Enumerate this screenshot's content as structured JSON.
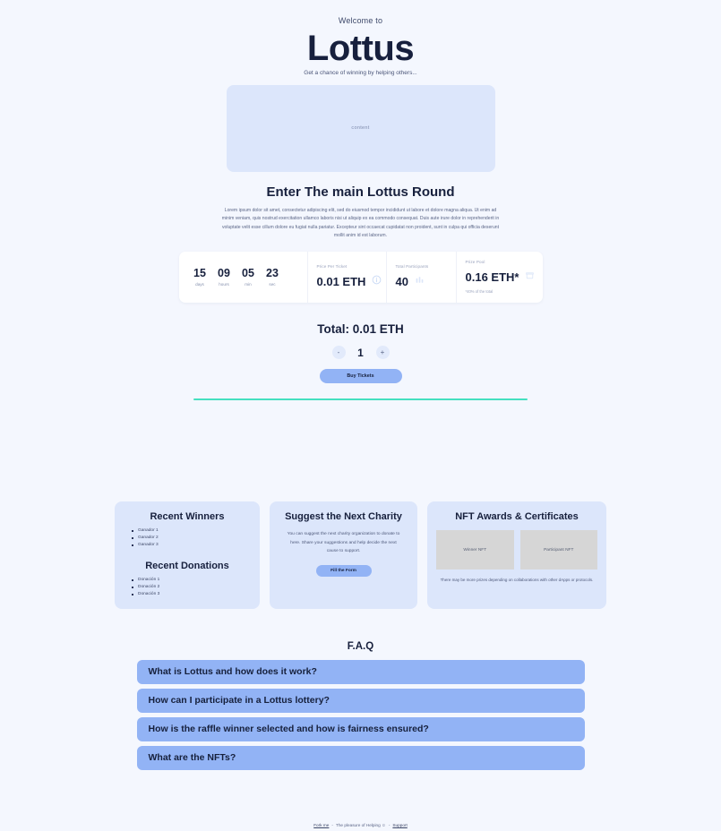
{
  "hero": {
    "welcome": "Welcome to",
    "brand": "Lottus",
    "tagline": "Get a chance of winning by helping others...",
    "media_placeholder": "content"
  },
  "round": {
    "title": "Enter The main Lottus Round",
    "description": "Lorem ipsum dolor sit amet, consectetur adipiscing elit, sed do eiusmod tempor incididunt ut labore et dolore magna aliqua. Ut enim ad minim veniam, quis nostrud exercitation ullamco laboris nisi ut aliquip ex ea commodo consequat. Duis aute irure dolor in reprehenderit in voluptate velit esse cillum dolore eu fugiat nulla pariatur. Excepteur sint occaecat cupidatat non proident, sunt in culpa qui officia deserunt mollit anim id est laborum."
  },
  "countdown": [
    {
      "value": "15",
      "label": "days"
    },
    {
      "value": "09",
      "label": "hours"
    },
    {
      "value": "05",
      "label": "min"
    },
    {
      "value": "23",
      "label": "sec"
    }
  ],
  "stats": {
    "price": {
      "label": "Price Per Ticket",
      "value": "0.01 ETH",
      "icon": "ticket-icon"
    },
    "participants": {
      "label": "Total Participants",
      "value": "40",
      "icon": "participants-icon"
    },
    "pool": {
      "label": "Prize Pool",
      "value": "0.16 ETH*",
      "note": "*40% of the total",
      "icon": "trophy-icon"
    }
  },
  "purchase": {
    "total_label": "Total: 0.01 ETH",
    "decrement": "-",
    "quantity": "1",
    "increment": "+",
    "buy_label": "Buy Tickets"
  },
  "winners_card": {
    "winners_title": "Recent Winners",
    "winners": [
      "Ganador 1",
      "Ganador 2",
      "Ganador 3"
    ],
    "donations_title": "Recent Donations",
    "donations": [
      "Donación 1",
      "Donación 2",
      "Donación 3"
    ]
  },
  "charity_card": {
    "title": "Suggest the Next Charity",
    "text": "You can suggest the next charity organization to donate to here. Share your suggestions and help decide the next cause to support.",
    "button": "Fill the Form"
  },
  "nft_card": {
    "title": "NFT Awards & Certificates",
    "thumbs": [
      "Winner NFT",
      "Participant NFT"
    ],
    "note": "There may be more prizes depending on collaborations with other dApps or protocols."
  },
  "faq": {
    "title": "F.A.Q",
    "items": [
      "What is Lottus and how does it work?",
      "How can I participate in a Lottus lottery?",
      "How is the raffle winner selected and how is fairness ensured?",
      "What are the NFTs?"
    ]
  },
  "footer": {
    "fork": "Fork me",
    "middle": "The pleasure of Helping ☺",
    "support": "Support",
    "separator": "-"
  },
  "colors": {
    "background": "#f4f7fe",
    "panel": "#dce6fb",
    "accent_button": "#92b3f5",
    "divider": "#45e0c0",
    "heading": "#17203d"
  }
}
